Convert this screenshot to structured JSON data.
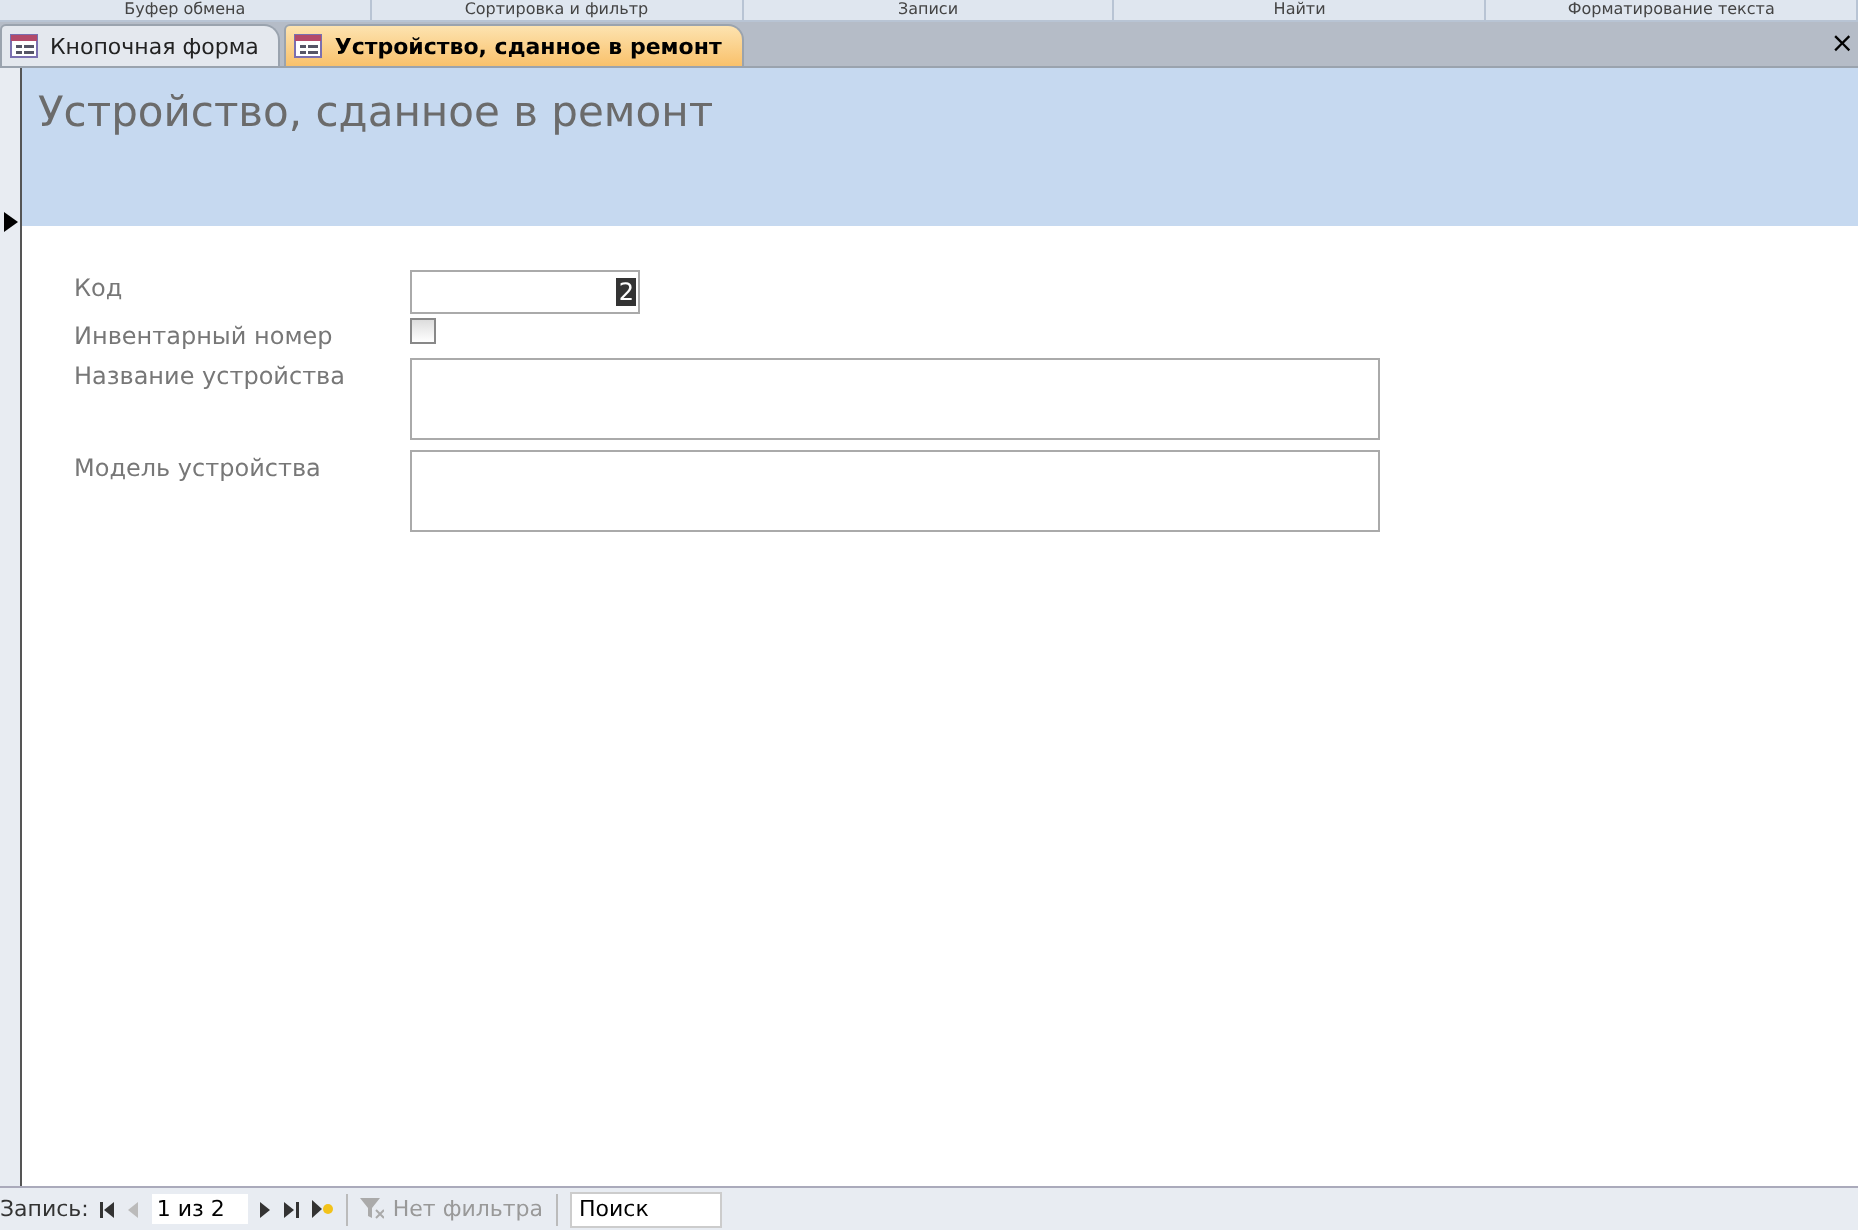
{
  "ribbon_groups": [
    "Буфер обмена",
    "Сортировка и фильтр",
    "Записи",
    "Найти",
    "Форматирование текста"
  ],
  "tabs": [
    {
      "label": "Кнопочная форма",
      "selected": false
    },
    {
      "label": "Устройство, сданное в ремонт",
      "selected": true
    }
  ],
  "close": "×",
  "form": {
    "title": "Устройство, сданное в ремонт",
    "fields": [
      {
        "kind": "text",
        "label": "Код",
        "value": "2"
      },
      {
        "kind": "checkbox",
        "label": "Инвентарный номер",
        "checked": false
      },
      {
        "kind": "memo",
        "label": "Название устройства"
      },
      {
        "kind": "memo",
        "label": "Модель устройства"
      }
    ]
  },
  "status_bar": {
    "record_label": "Запись:",
    "record_value": "1 из 2",
    "filter": "Нет фильтра",
    "search": {
      "placeholder": "Поиск"
    }
  }
}
